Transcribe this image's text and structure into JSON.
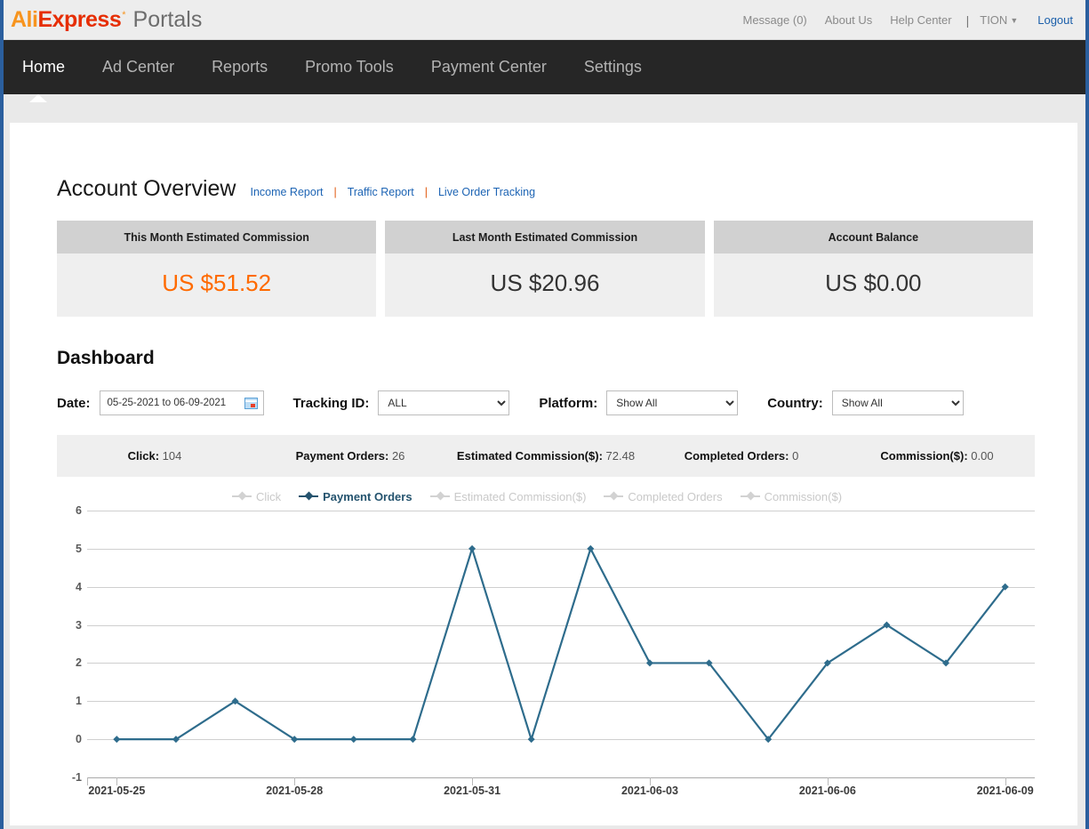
{
  "header": {
    "logo": {
      "ali": "Ali",
      "express": "Express",
      "star": "*",
      "portals": "Portals"
    },
    "right_links": [
      {
        "label": "Message (0)",
        "name": "message-link"
      },
      {
        "label": "About Us",
        "name": "about-us-link"
      },
      {
        "label": "Help Center",
        "name": "help-center-link"
      }
    ],
    "separator": "|",
    "user": "TION",
    "user_caret": "▼",
    "logout": "Logout"
  },
  "nav": {
    "items": [
      {
        "label": "Home",
        "active": true
      },
      {
        "label": "Ad Center",
        "active": false
      },
      {
        "label": "Reports",
        "active": false
      },
      {
        "label": "Promo Tools",
        "active": false
      },
      {
        "label": "Payment Center",
        "active": false
      },
      {
        "label": "Settings",
        "active": false
      }
    ]
  },
  "account_overview": {
    "title": "Account Overview",
    "links": [
      {
        "label": "Income Report"
      },
      {
        "label": "Traffic Report"
      },
      {
        "label": "Live Order Tracking"
      }
    ],
    "link_separator": "|",
    "cards": [
      {
        "title": "This Month Estimated Commission",
        "value": "US $51.52",
        "accent": true
      },
      {
        "title": "Last Month Estimated Commission",
        "value": "US $20.96",
        "accent": false
      },
      {
        "title": "Account Balance",
        "value": "US $0.00",
        "accent": false
      }
    ]
  },
  "dashboard": {
    "title": "Dashboard",
    "filters": {
      "date_label": "Date:",
      "date_value": "05-25-2021 to 06-09-2021",
      "calendar_icon": "calendar-icon",
      "tracking_label": "Tracking ID:",
      "tracking_value": "ALL",
      "tracking_options": [
        "ALL"
      ],
      "platform_label": "Platform:",
      "platform_value": "Show All",
      "platform_options": [
        "Show All"
      ],
      "country_label": "Country:",
      "country_value": "Show All",
      "country_options": [
        "Show All"
      ]
    },
    "stats": [
      {
        "key": "Click:",
        "value": "104"
      },
      {
        "key": "Payment Orders:",
        "value": "26"
      },
      {
        "key": "Estimated Commission($):",
        "value": "72.48"
      },
      {
        "key": "Completed Orders:",
        "value": "0"
      },
      {
        "key": "Commission($):",
        "value": "0.00"
      }
    ]
  },
  "colors": {
    "accent_orange": "#ff6a00",
    "series_blue": "#2e6c8c",
    "legend_inactive": "#c9c9c9",
    "nav_bg": "#262626",
    "link_blue": "#1d64b4"
  },
  "chart_data": {
    "type": "line",
    "title": "",
    "xlabel": "",
    "ylabel": "",
    "ylim": [
      -1,
      6
    ],
    "yticks": [
      6,
      5,
      4,
      3,
      2,
      1,
      0,
      -1
    ],
    "grid": true,
    "legend_position": "top-center",
    "x": [
      "2021-05-25",
      "2021-05-26",
      "2021-05-27",
      "2021-05-28",
      "2021-05-29",
      "2021-05-30",
      "2021-05-31",
      "2021-06-01",
      "2021-06-02",
      "2021-06-03",
      "2021-06-04",
      "2021-06-05",
      "2021-06-06",
      "2021-06-07",
      "2021-06-08",
      "2021-06-09"
    ],
    "xtick_labels": [
      "2021-05-25",
      "2021-05-28",
      "2021-05-31",
      "2021-06-03",
      "2021-06-06",
      "2021-06-09"
    ],
    "series": [
      {
        "name": "Click",
        "active": false,
        "values": []
      },
      {
        "name": "Payment Orders",
        "active": true,
        "values": [
          0,
          0,
          1,
          0,
          0,
          0,
          5,
          0,
          5,
          2,
          2,
          0,
          2,
          3,
          2,
          4
        ]
      },
      {
        "name": "Estimated Commission($)",
        "active": false,
        "values": []
      },
      {
        "name": "Completed Orders",
        "active": false,
        "values": []
      },
      {
        "name": "Commission($)",
        "active": false,
        "values": []
      }
    ]
  }
}
